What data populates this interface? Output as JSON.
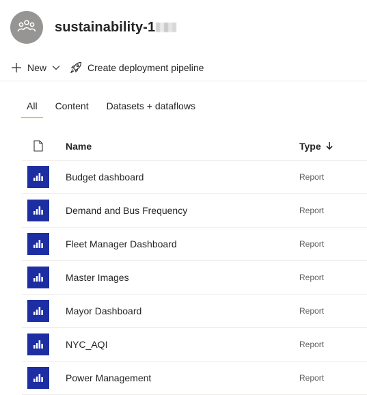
{
  "workspace": {
    "title": "sustainability-1",
    "avatar_icon": "group-people-icon"
  },
  "toolbar": {
    "new_label": "New",
    "new_icon": "plus-icon",
    "new_chevron": "chevron-down-icon",
    "deploy_label": "Create deployment pipeline",
    "deploy_icon": "rocket-icon"
  },
  "tabs": [
    {
      "label": "All",
      "active": true
    },
    {
      "label": "Content",
      "active": false
    },
    {
      "label": "Datasets + dataflows",
      "active": false
    }
  ],
  "table": {
    "header_icon": "document-icon",
    "columns": {
      "name": "Name",
      "type": "Type",
      "sort_icon": "arrow-down-icon"
    },
    "rows": [
      {
        "name": "Budget dashboard",
        "type": "Report",
        "icon": "report-icon"
      },
      {
        "name": "Demand and Bus Frequency",
        "type": "Report",
        "icon": "report-icon"
      },
      {
        "name": "Fleet Manager Dashboard",
        "type": "Report",
        "icon": "report-icon"
      },
      {
        "name": "Master Images",
        "type": "Report",
        "icon": "report-icon"
      },
      {
        "name": "Mayor Dashboard",
        "type": "Report",
        "icon": "report-icon"
      },
      {
        "name": "NYC_AQI",
        "type": "Report",
        "icon": "report-icon"
      },
      {
        "name": "Power Management",
        "type": "Report",
        "icon": "report-icon"
      }
    ]
  },
  "colors": {
    "accent_tab": "#f2c811",
    "report_icon_bg": "#1c2ea2",
    "avatar_bg": "#979593"
  }
}
